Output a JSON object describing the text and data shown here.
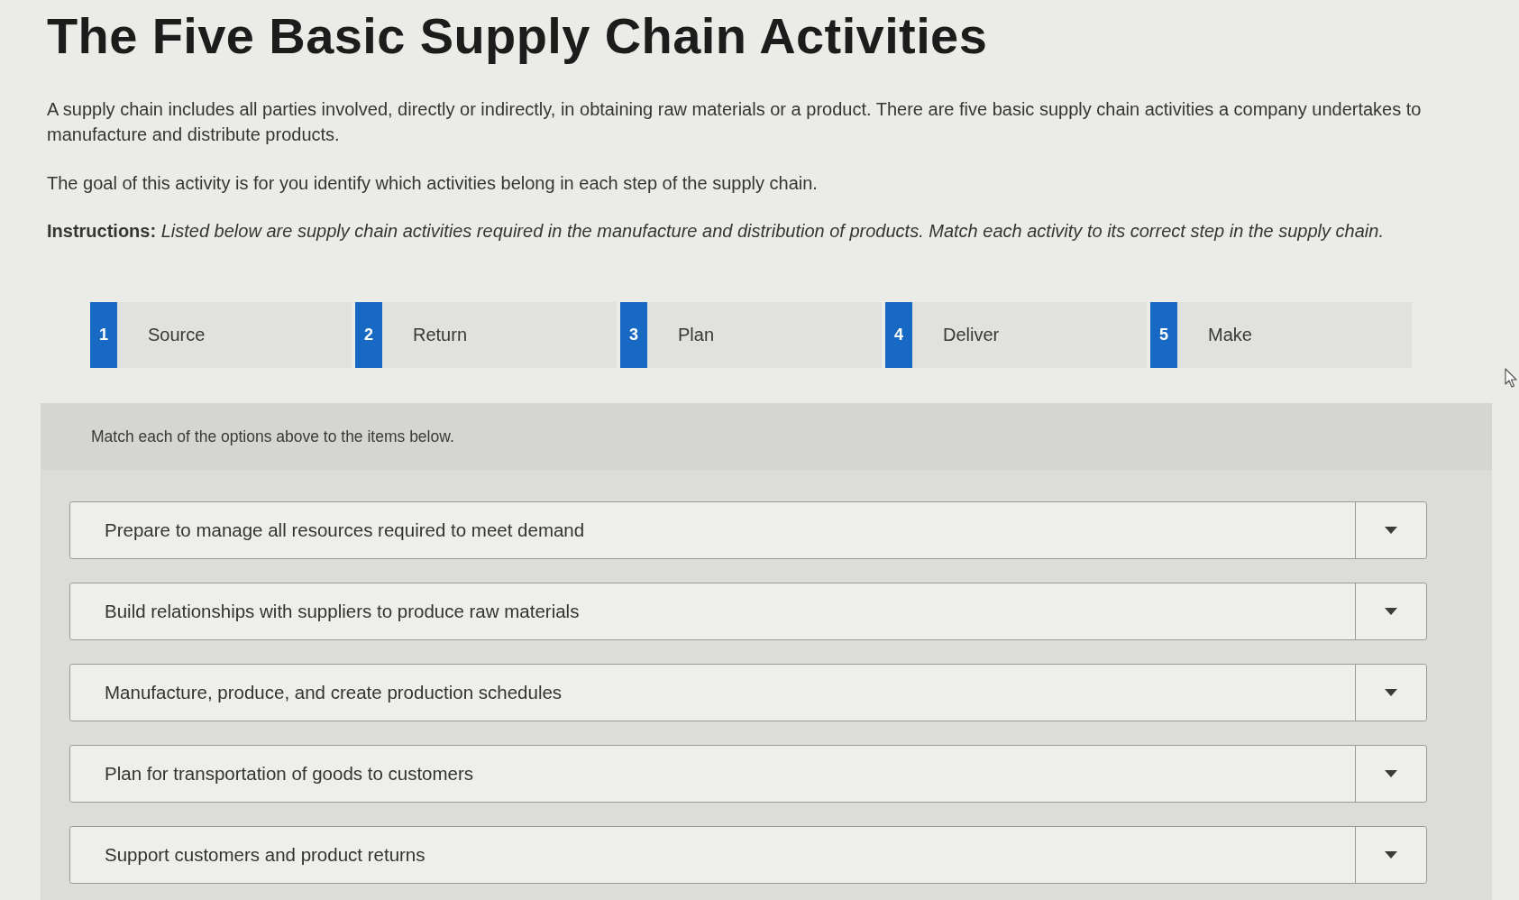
{
  "title": "The Five Basic Supply Chain Activities",
  "intro": [
    "A supply chain includes all parties involved, directly or indirectly, in obtaining raw materials or a product. There are five basic supply chain activities a company undertakes to manufacture and distribute products.",
    "The goal of this activity is for you identify which activities belong in each step of the supply chain."
  ],
  "instructions": "**Instructions:** *Listed below are supply chain activities required in the manufacture and distribution of products. Match each activity to its correct step in the supply chain.*",
  "options": [
    {
      "number": "1",
      "label": "Source"
    },
    {
      "number": "2",
      "label": "Return"
    },
    {
      "number": "3",
      "label": "Plan"
    },
    {
      "number": "4",
      "label": "Deliver"
    },
    {
      "number": "5",
      "label": "Make"
    }
  ],
  "matching": {
    "prompt": "Match each of the options above to the items below.",
    "items": [
      {
        "text": "Prepare to manage all resources required to meet demand"
      },
      {
        "text": "Build relationships with suppliers to produce raw materials"
      },
      {
        "text": "Manufacture, produce, and create production schedules"
      },
      {
        "text": "Plan for transportation of goods to customers"
      },
      {
        "text": "Support customers and product returns"
      }
    ]
  }
}
